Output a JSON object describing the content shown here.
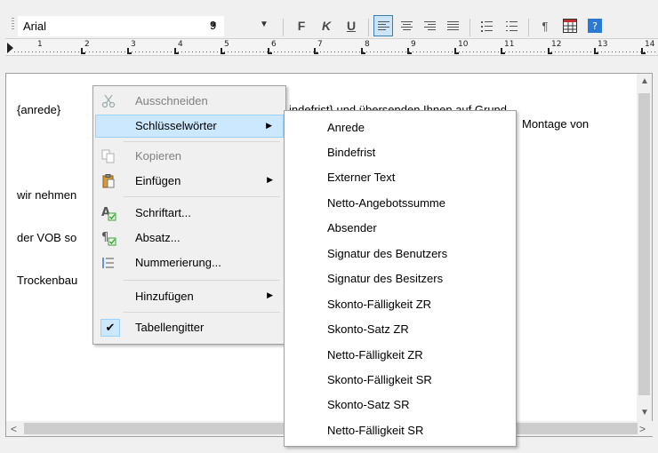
{
  "toolbar": {
    "font_name": "Arial",
    "font_size": "9",
    "bold_label": "F",
    "italic_label": "K",
    "underline_label": "U",
    "pilcrow": "¶"
  },
  "ruler": {
    "numbers": [
      "1",
      "2",
      "3",
      "4",
      "5",
      "6",
      "7",
      "8",
      "9",
      "10",
      "11",
      "12",
      "13",
      "14"
    ]
  },
  "document": {
    "lines": [
      "{anrede}",
      "",
      "wir nehmen",
      "der VOB so",
      "Trockenbau"
    ],
    "line2_right": "indefrist} und übersenden Ihnen auf Grund",
    "line3_right": "Montage von"
  },
  "context_menu": {
    "items": [
      {
        "label": "Ausschneiden",
        "icon": "scissors-icon",
        "disabled": true
      },
      {
        "label": "Schlüsselwörter",
        "has_submenu": true,
        "highlighted": true
      },
      {
        "label": "Kopieren",
        "icon": "copy-icon",
        "disabled": true
      },
      {
        "label": "Einfügen",
        "icon": "paste-icon",
        "has_submenu": true
      },
      {
        "label": "Schriftart...",
        "icon": "font-icon"
      },
      {
        "label": "Absatz...",
        "icon": "paragraph-icon"
      },
      {
        "label": "Nummerierung...",
        "icon": "numbering-icon"
      },
      {
        "label": "Hinzufügen",
        "has_submenu": true
      },
      {
        "label": "Tabellengitter",
        "checked": true
      }
    ]
  },
  "submenu": {
    "items": [
      "Anrede",
      "Bindefrist",
      "Externer Text",
      "Netto-Angebotssumme",
      "Absender",
      "Signatur des Benutzers",
      "Signatur des Besitzers",
      "Skonto-Fälligkeit ZR",
      "Skonto-Satz ZR",
      "Netto-Fälligkeit ZR",
      "Skonto-Fälligkeit SR",
      "Skonto-Satz SR",
      "Netto-Fälligkeit SR"
    ]
  },
  "colors": {
    "highlight": "#cce8ff",
    "highlight_border": "#99d1ff",
    "active_button": "#cce4f7"
  }
}
